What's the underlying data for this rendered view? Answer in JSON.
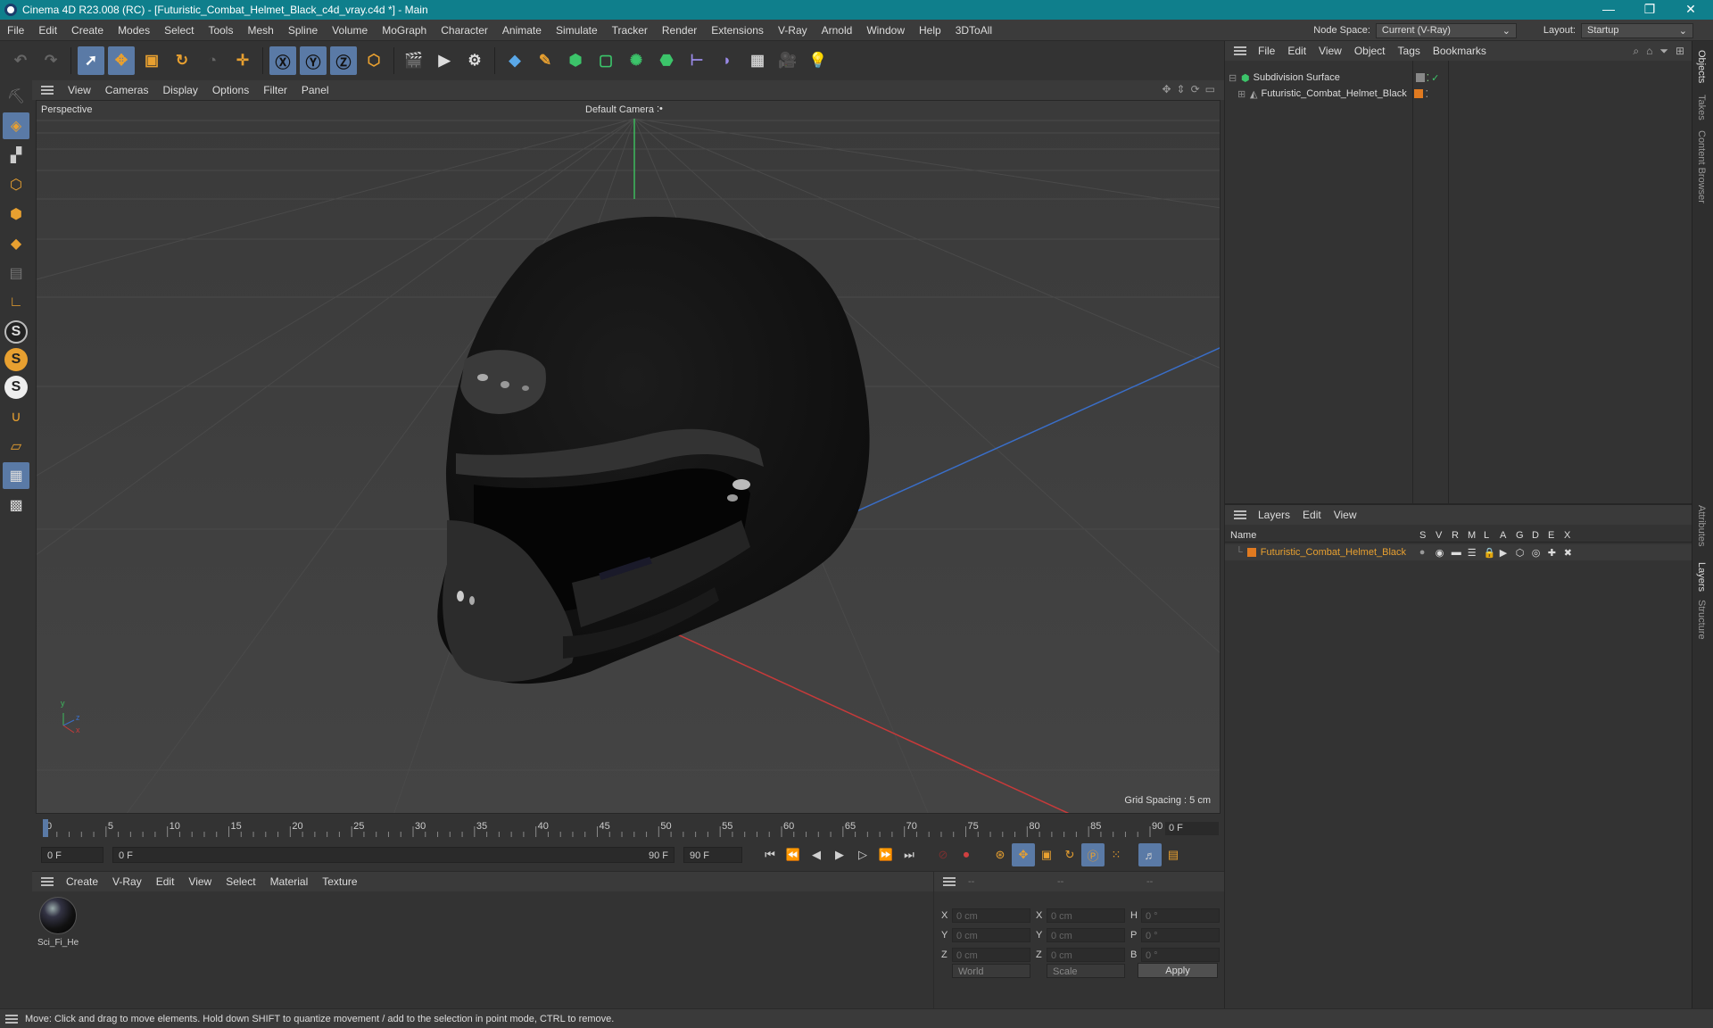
{
  "window": {
    "title": "Cinema 4D R23.008 (RC) - [Futuristic_Combat_Helmet_Black_c4d_vray.c4d *] - Main",
    "minimize": "—",
    "restore": "❐",
    "close": "✕"
  },
  "menubar": {
    "items": [
      "File",
      "Edit",
      "Create",
      "Modes",
      "Select",
      "Tools",
      "Mesh",
      "Spline",
      "Volume",
      "MoGraph",
      "Character",
      "Animate",
      "Simulate",
      "Tracker",
      "Render",
      "Extensions",
      "V-Ray",
      "Arnold",
      "Window",
      "Help",
      "3DToAll"
    ],
    "node_space_label": "Node Space:",
    "node_space_value": "Current (V-Ray)",
    "layout_label": "Layout:",
    "layout_value": "Startup"
  },
  "viewport": {
    "menu": [
      "View",
      "Cameras",
      "Display",
      "Options",
      "Filter",
      "Panel"
    ],
    "projection": "Perspective",
    "camera": "Default Camera",
    "camera_marker": ":•",
    "grid_spacing": "Grid Spacing : 5 cm",
    "axis_y": "y",
    "axis_z": "z",
    "axis_x": "x"
  },
  "timeline": {
    "ticks": [
      "0",
      "5",
      "10",
      "15",
      "20",
      "25",
      "30",
      "35",
      "40",
      "45",
      "50",
      "55",
      "60",
      "65",
      "70",
      "75",
      "80",
      "85",
      "90"
    ],
    "current_frame": "0 F"
  },
  "playbar": {
    "start_field": "0 F",
    "range_start": "0 F",
    "range_end": "90 F",
    "end_field": "90 F"
  },
  "material_panel": {
    "menu": [
      "Create",
      "V-Ray",
      "Edit",
      "View",
      "Select",
      "Material",
      "Texture"
    ],
    "material_name": "Sci_Fi_He"
  },
  "coord_panel": {
    "head": [
      "--",
      "--",
      "--"
    ],
    "rows": [
      {
        "l1": "X",
        "v1": "0 cm",
        "l2": "X",
        "v2": "0 cm",
        "l3": "H",
        "v3": "0 °"
      },
      {
        "l1": "Y",
        "v1": "0 cm",
        "l2": "Y",
        "v2": "0 cm",
        "l3": "P",
        "v3": "0 °"
      },
      {
        "l1": "Z",
        "v1": "0 cm",
        "l2": "Z",
        "v2": "0 cm",
        "l3": "B",
        "v3": "0 °"
      }
    ],
    "coord_system": "World",
    "mode": "Scale",
    "apply": "Apply"
  },
  "object_panel": {
    "menu": [
      "File",
      "Edit",
      "View",
      "Object",
      "Tags",
      "Bookmarks"
    ],
    "objects": [
      {
        "name": "Subdivision Surface"
      },
      {
        "name": "Futuristic_Combat_Helmet_Black"
      }
    ]
  },
  "layers_panel": {
    "menu": [
      "Layers",
      "Edit",
      "View"
    ],
    "columns": [
      "Name",
      "S",
      "V",
      "R",
      "M",
      "L",
      "A",
      "G",
      "D",
      "E",
      "X"
    ],
    "layer_name": "Futuristic_Combat_Helmet_Black",
    "layer_color": "#e07a20"
  },
  "right_tabs": [
    "Objects",
    "Takes",
    "Content Browser",
    "Attributes",
    "Layers",
    "Structure"
  ],
  "status": "Move: Click and drag to move elements. Hold down SHIFT to quantize movement / add to the selection in point mode, CTRL to remove.",
  "colors": {
    "title_bar": "#0f7f8c",
    "accent": "#5a7aa6",
    "icon_orange": "#e8a030"
  }
}
